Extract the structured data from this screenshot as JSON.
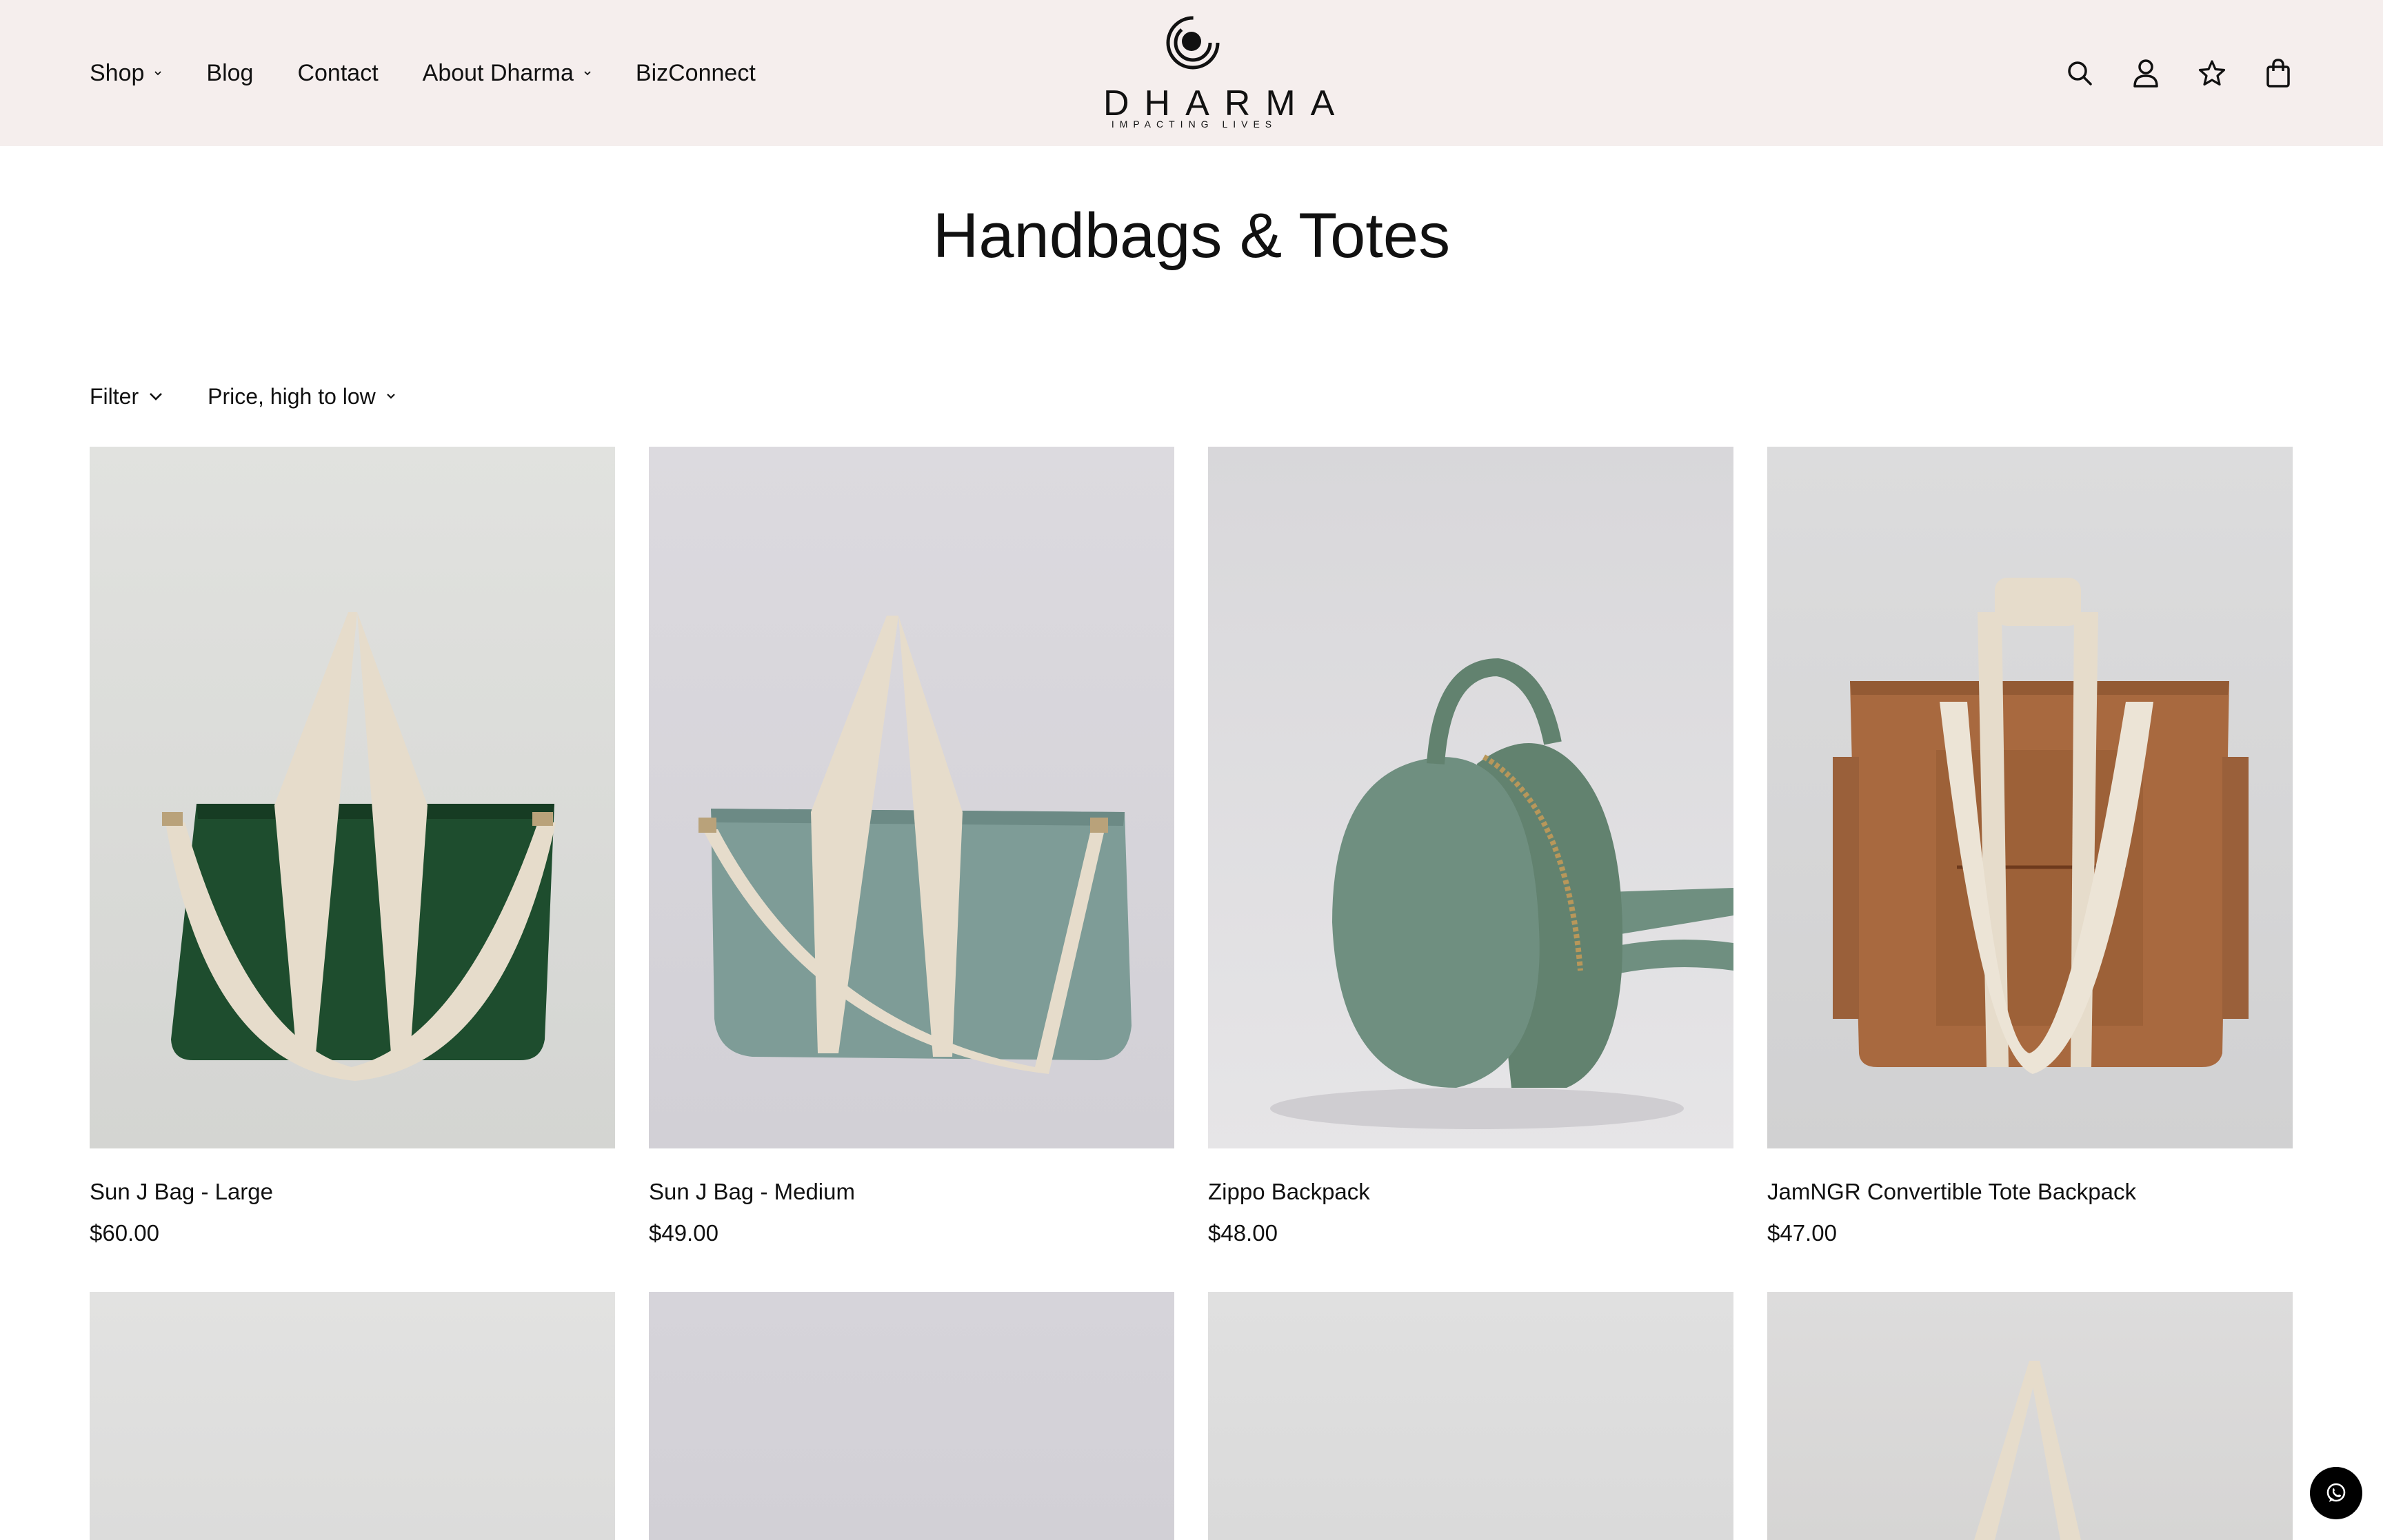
{
  "header": {
    "nav": [
      {
        "label": "Shop",
        "has_dropdown": true
      },
      {
        "label": "Blog",
        "has_dropdown": false
      },
      {
        "label": "Contact",
        "has_dropdown": false
      },
      {
        "label": "About Dharma",
        "has_dropdown": true
      },
      {
        "label": "BizConnect",
        "has_dropdown": false
      }
    ],
    "logo": {
      "wordmark": "DHARMA",
      "tagline": "IMPACTING LIVES"
    },
    "icons": [
      "search-icon",
      "account-icon",
      "wishlist-star-icon",
      "cart-bag-icon"
    ]
  },
  "page": {
    "title": "Handbags & Totes"
  },
  "toolbar": {
    "filter_label": "Filter",
    "sort_label": "Price, high to low"
  },
  "products": [
    {
      "name": "Sun J Bag - Large",
      "price": "$60.00",
      "bag_color": "#1e4d2e"
    },
    {
      "name": "Sun J Bag - Medium",
      "price": "$49.00",
      "bag_color": "#7e9c97"
    },
    {
      "name": "Zippo Backpack",
      "price": "$48.00",
      "bag_color": "#6f8f80"
    },
    {
      "name": "JamNGR Convertible Tote Backpack",
      "price": "$47.00",
      "bag_color": "#a8693f"
    }
  ],
  "colors": {
    "header_bg": "#f5eeed",
    "strap": "#e6dccb",
    "image_bg": "#dcdbdd"
  }
}
